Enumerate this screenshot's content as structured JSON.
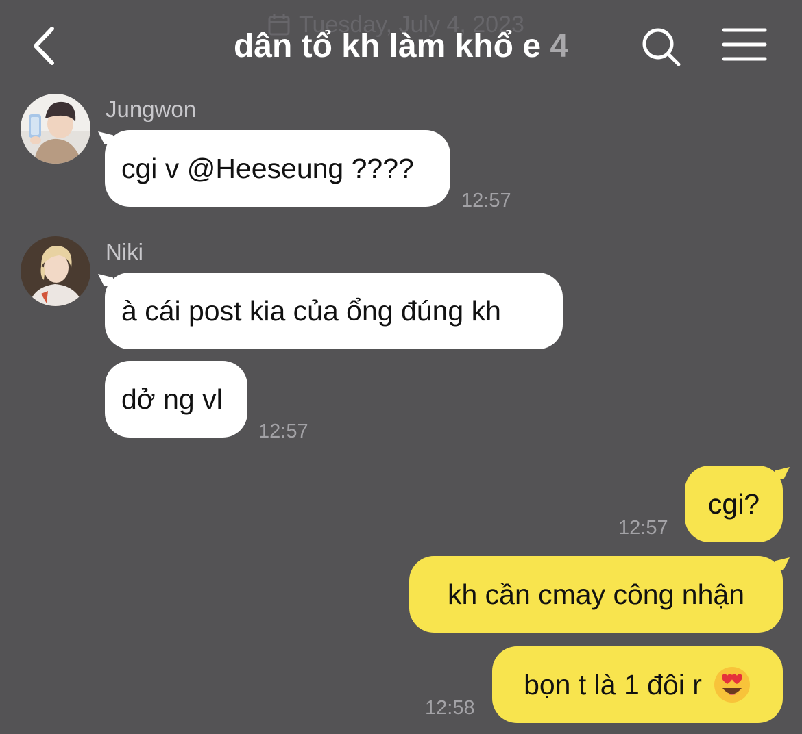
{
  "header": {
    "date_watermark": "Tuesday, July 4, 2023",
    "title": "dân tổ kh làm khổ e",
    "member_count": "4"
  },
  "icons": {
    "back": "chevron-left-icon",
    "search": "search-icon",
    "menu": "hamburger-menu-icon",
    "calendar": "calendar-icon",
    "emoji": "smiling-face-with-heart-eyes-emoji"
  },
  "colors": {
    "background": "#545355",
    "incoming_bubble": "#ffffff",
    "outgoing_bubble": "#f8e44e"
  },
  "messages": [
    {
      "sender": "Jungwon",
      "direction": "incoming",
      "bubbles": [
        "cgi v @Heeseung ????"
      ],
      "time": "12:57"
    },
    {
      "sender": "Niki",
      "direction": "incoming",
      "bubbles": [
        "à cái post kia của ổng đúng kh",
        "dở ng vl"
      ],
      "time": "12:57"
    },
    {
      "sender": "",
      "direction": "outgoing",
      "bubbles": [
        "cgi?"
      ],
      "time": "12:57"
    },
    {
      "sender": "",
      "direction": "outgoing",
      "bubbles": [
        "kh cần cmay công nhận",
        "bọn t là 1 đôi r"
      ],
      "time": "12:58"
    }
  ]
}
